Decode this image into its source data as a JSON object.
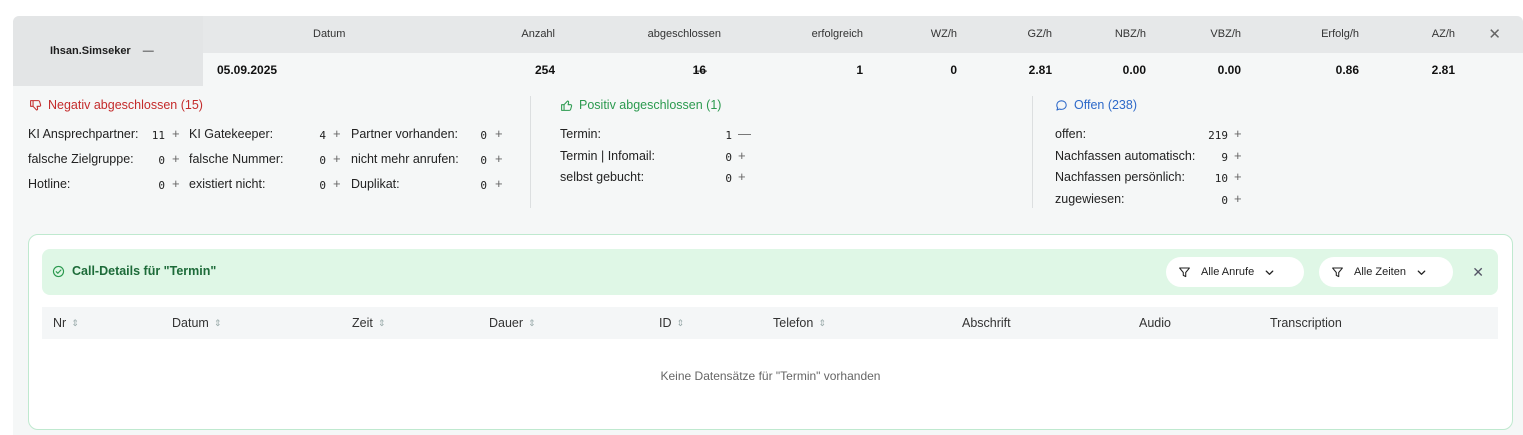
{
  "user": {
    "name": "Ihsan.Simseker",
    "toggle": "—"
  },
  "header": {
    "columns": [
      "Datum",
      "Anzahl",
      "abgeschlossen",
      "erfolgreich",
      "WZ/h",
      "GZ/h",
      "NBZ/h",
      "VBZ/h",
      "Erfolg/h",
      "AZ/h"
    ],
    "values": [
      "05.09.2025",
      "254",
      "16",
      "1",
      "0",
      "2.81",
      "0.00",
      "0.00",
      "0.86",
      "2.81"
    ],
    "abgeschlossen_toggle": "—",
    "close": "✕"
  },
  "negative": {
    "title": "Negativ abgeschlossen (15)",
    "items": [
      {
        "label": "KI Ansprechpartner:",
        "count": "11",
        "sign": "+"
      },
      {
        "label": "KI Gatekeeper:",
        "count": "4",
        "sign": "+"
      },
      {
        "label": "Partner vorhanden:",
        "count": "0",
        "sign": "+"
      },
      {
        "label": "falsche Zielgruppe:",
        "count": "0",
        "sign": "+"
      },
      {
        "label": "falsche Nummer:",
        "count": "0",
        "sign": "+"
      },
      {
        "label": "nicht mehr anrufen:",
        "count": "0",
        "sign": "+"
      },
      {
        "label": "Hotline:",
        "count": "0",
        "sign": "+"
      },
      {
        "label": "existiert nicht:",
        "count": "0",
        "sign": "+"
      },
      {
        "label": "Duplikat:",
        "count": "0",
        "sign": "+"
      }
    ]
  },
  "positive": {
    "title": "Positiv abgeschlossen (1)",
    "items": [
      {
        "label": "Termin:",
        "count": "1",
        "sign": "—"
      },
      {
        "label": "Termin | Infomail:",
        "count": "0",
        "sign": "+"
      },
      {
        "label": "selbst gebucht:",
        "count": "0",
        "sign": "+"
      }
    ]
  },
  "open": {
    "title": "Offen (238)",
    "items": [
      {
        "label": "offen:",
        "count": "219",
        "sign": "+"
      },
      {
        "label": "Nachfassen automatisch:",
        "count": "9",
        "sign": "+"
      },
      {
        "label": "Nachfassen persönlich:",
        "count": "10",
        "sign": "+"
      },
      {
        "label": "zugewiesen:",
        "count": "0",
        "sign": "+"
      }
    ]
  },
  "details": {
    "title": "Call-Details für \"Termin\"",
    "filter_calls": "Alle Anrufe",
    "filter_times": "Alle Zeiten",
    "close": "✕",
    "columns": [
      "Nr",
      "Datum",
      "Zeit",
      "Dauer",
      "ID",
      "Telefon",
      "Abschrift",
      "Audio",
      "Transcription"
    ],
    "empty_text": "Keine Datensätze für \"Termin\" vorhanden"
  },
  "colors": {
    "negative": "#c42b2b",
    "positive": "#2b9a4f",
    "open": "#2d69c9",
    "card_header": "#dff7e6"
  }
}
